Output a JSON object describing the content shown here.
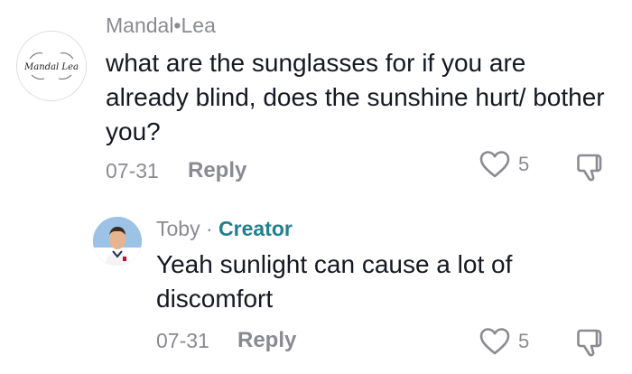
{
  "comments": [
    {
      "username": "Mandal•Lea",
      "avatar_text": "Mandal Lea",
      "text": "what are the sunglasses for if you are already blind, does the sunshine hurt/ bother you?",
      "date": "07-31",
      "reply_label": "Reply",
      "like_count": "5",
      "icons": {
        "like": "heart-outline-icon",
        "dislike": "thumbs-down-icon"
      }
    },
    {
      "username": "Toby",
      "separator": " · ",
      "badge": "Creator",
      "text": "Yeah sunlight can cause a lot of discomfort",
      "date": "07-31",
      "reply_label": "Reply",
      "like_count": "5",
      "icons": {
        "like": "heart-outline-icon",
        "dislike": "thumbs-down-icon"
      }
    }
  ],
  "colors": {
    "muted_text": "#8a8b91",
    "primary_text": "#161823",
    "creator_badge": "#20808f",
    "background": "#ffffff"
  }
}
